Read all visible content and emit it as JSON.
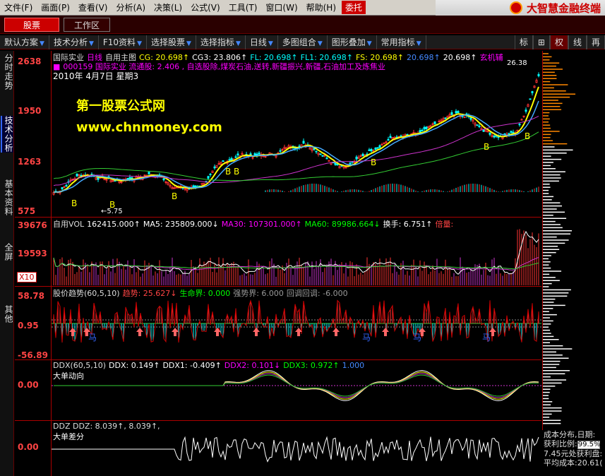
{
  "menu": [
    "文件(F)",
    "画面(P)",
    "查看(V)",
    "分析(A)",
    "决策(L)",
    "公式(V)",
    "工具(T)",
    "窗口(W)",
    "帮助(H)"
  ],
  "menu_extra": "委托",
  "brand": "大智慧金融终端",
  "tabs": {
    "stock": "股票",
    "workspace": "工作区"
  },
  "toolbar": {
    "items": [
      "默认方案",
      "技术分析",
      "F10资料",
      "选择股票",
      "选择指标",
      "日线",
      "多图组合",
      "图形叠加",
      "常用指标"
    ],
    "right": [
      "标",
      "⊞",
      "权",
      "线",
      "再"
    ]
  },
  "side_tabs": [
    "分时走势",
    "技术分析",
    "基本资料",
    "全屏",
    "其他"
  ],
  "price_panel": {
    "y_labels": [
      "2638",
      "1950",
      "1263",
      "575"
    ],
    "header1": [
      {
        "t": "国际实业",
        "c": "#ddd"
      },
      {
        "t": "日线",
        "c": "#f0f"
      },
      {
        "t": "自用主图",
        "c": "#ddd"
      },
      {
        "t": "CG: 20.698↑",
        "c": "#ff0"
      },
      {
        "t": "CG3: 23.806↑",
        "c": "#fff"
      },
      {
        "t": "FL: 20.698↑",
        "c": "#0ff"
      },
      {
        "t": "FL1: 20.698↑",
        "c": "#0ff"
      },
      {
        "t": "FS: 20.698↑",
        "c": "#ff0"
      },
      {
        "t": "20.698↑",
        "c": "#48f"
      },
      {
        "t": "20.698↑",
        "c": "#fff"
      },
      {
        "t": "玄机辅",
        "c": "#f0f"
      }
    ],
    "header2": "000159 国际实业 流通股: 2.406 , 自选股除,煤炭石油,送转,新疆振兴,新疆,石油加工及炼焦业",
    "date": "2010年 4月7日 星期3",
    "low_label": "5.75",
    "high_label": "26.38",
    "watermark1": "第一股票公式网",
    "watermark2": "www.chnmoney.com",
    "b_markers": [
      "B",
      "B",
      "B",
      "B",
      "B",
      "B",
      "B",
      "B"
    ]
  },
  "vol_panel": {
    "y_labels": [
      "39676",
      "19593"
    ],
    "badge": "X10",
    "header": [
      {
        "t": "自用VOL",
        "c": "#ddd"
      },
      {
        "t": "162415.000↑",
        "c": "#fff"
      },
      {
        "t": "MA5: 235809.000↓",
        "c": "#fff"
      },
      {
        "t": "MA30: 107301.000↑",
        "c": "#f0f"
      },
      {
        "t": "MA60: 89986.664↓",
        "c": "#0f0"
      },
      {
        "t": "换手: 6.751↑",
        "c": "#fff"
      },
      {
        "t": "倍量:",
        "c": "#f44"
      }
    ]
  },
  "trend_panel": {
    "y_labels": [
      "58.78",
      "0.95",
      "-56.89"
    ],
    "header": [
      {
        "t": "股价趋势(60,5,10)",
        "c": "#ddd"
      },
      {
        "t": "趋势: 25.627↓",
        "c": "#f44"
      },
      {
        "t": "生命界: 0.000",
        "c": "#0f0"
      },
      {
        "t": "强势界: 6.000",
        "c": "#999"
      },
      {
        "t": "回调回调: -6.000",
        "c": "#999"
      }
    ],
    "ma_label": "马"
  },
  "ddx_panel": {
    "y_labels": [
      "0.00"
    ],
    "header": [
      {
        "t": "DDX(60,5,10)",
        "c": "#ddd"
      },
      {
        "t": "DDX: 0.149↑",
        "c": "#fff"
      },
      {
        "t": "DDX1: -0.409↑",
        "c": "#fff"
      },
      {
        "t": "DDX2: 0.101↓",
        "c": "#f0f"
      },
      {
        "t": "DDX3: 0.972↑",
        "c": "#0f0"
      },
      {
        "t": "1.000",
        "c": "#48f"
      }
    ],
    "sub": "大单动向"
  },
  "ddz_panel": {
    "y_labels": [
      "0.00"
    ],
    "header": [
      {
        "t": "DDZ DDZ: 8.039↑, 8.039↑,",
        "c": "#ddd"
      }
    ],
    "sub": "大单差分"
  },
  "cost_panel": {
    "line1": "成本分布,日期:",
    "line2": "获利比例:",
    "ratio": "99.5%",
    "line3": "7.45元处获利盘:",
    "line4": "平均成本:20.61("
  },
  "colors": {
    "accent": "#cc0000",
    "up": "#ff3333",
    "down": "#00ffff"
  }
}
